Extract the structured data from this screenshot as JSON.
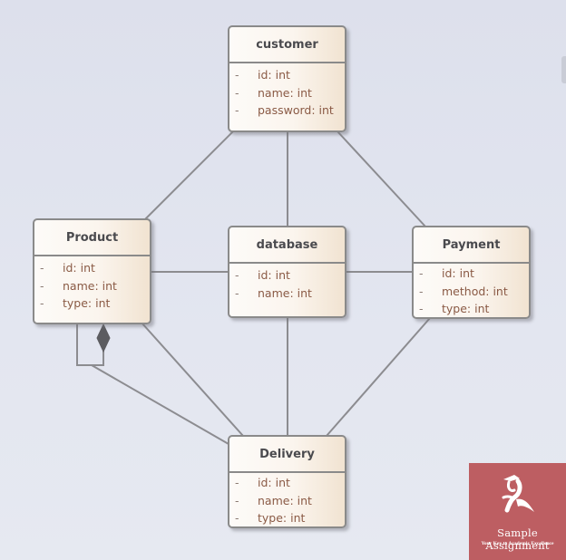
{
  "diagram": {
    "type": "UML class diagram",
    "classes": [
      {
        "name": "customer",
        "attributes": [
          {
            "visibility": "-",
            "text": "id: int"
          },
          {
            "visibility": "-",
            "text": "name: int"
          },
          {
            "visibility": "-",
            "text": "password: int"
          }
        ]
      },
      {
        "name": "Product",
        "attributes": [
          {
            "visibility": "-",
            "text": "id: int"
          },
          {
            "visibility": "-",
            "text": "name: int"
          },
          {
            "visibility": "-",
            "text": "type: int"
          }
        ]
      },
      {
        "name": "database",
        "attributes": [
          {
            "visibility": "-",
            "text": "id: int"
          },
          {
            "visibility": "-",
            "text": "name: int"
          }
        ]
      },
      {
        "name": "Payment",
        "attributes": [
          {
            "visibility": "-",
            "text": "id: int"
          },
          {
            "visibility": "-",
            "text": "method: int"
          },
          {
            "visibility": "-",
            "text": "type: int"
          }
        ]
      },
      {
        "name": "Delivery",
        "attributes": [
          {
            "visibility": "-",
            "text": "id: int"
          },
          {
            "visibility": "-",
            "text": "name: int"
          },
          {
            "visibility": "-",
            "text": "type: int"
          }
        ]
      }
    ],
    "relationships": [
      {
        "from": "customer",
        "to": "Product",
        "kind": "association"
      },
      {
        "from": "customer",
        "to": "database",
        "kind": "association"
      },
      {
        "from": "customer",
        "to": "Payment",
        "kind": "association"
      },
      {
        "from": "Product",
        "to": "database",
        "kind": "association"
      },
      {
        "from": "database",
        "to": "Payment",
        "kind": "association"
      },
      {
        "from": "Product",
        "to": "Delivery",
        "kind": "association"
      },
      {
        "from": "database",
        "to": "Delivery",
        "kind": "association"
      },
      {
        "from": "Payment",
        "to": "Delivery",
        "kind": "association"
      },
      {
        "from": "Product",
        "to": "Product",
        "kind": "composition (self)"
      },
      {
        "from": "Product",
        "to": "Delivery",
        "kind": "association (via self-loop)"
      }
    ]
  },
  "colors": {
    "background": "#dfe2ed",
    "class_border": "#8a8a8a",
    "class_name_text": "#4a4a4e",
    "attribute_text": "#8a5a45",
    "line": "#8c8c90",
    "logo_background": "#bd5e62"
  },
  "watermark": {
    "brand": "Sample Assignment",
    "tagline": "Your Key to Academic Excellence",
    "icon": "graduate-figure-icon"
  }
}
